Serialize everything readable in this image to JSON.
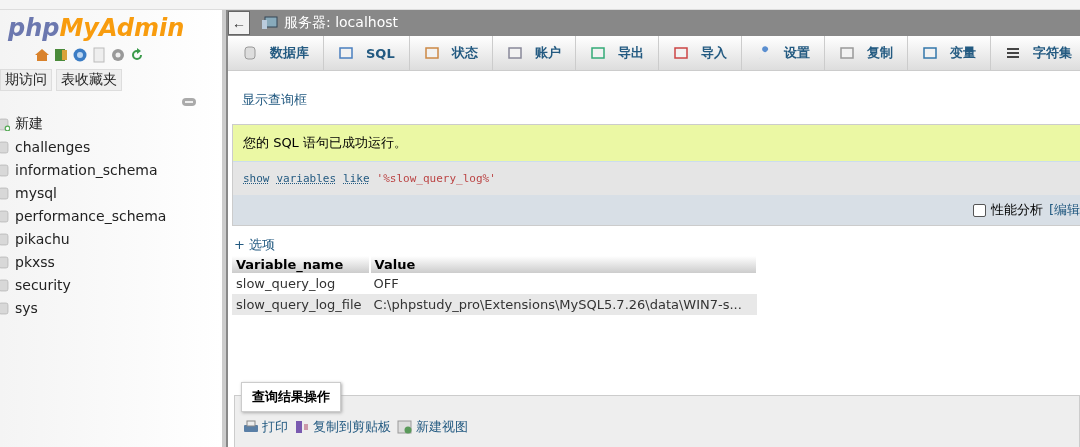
{
  "sidebar": {
    "logo": {
      "part1": "php",
      "part2": "MyAdmin"
    },
    "tabs": [
      {
        "label": "期访问",
        "selected": false
      },
      {
        "label": "表收藏夹",
        "selected": false
      }
    ],
    "tree": [
      {
        "label": "新建",
        "kind": "new"
      },
      {
        "label": "challenges",
        "kind": "db"
      },
      {
        "label": "information_schema",
        "kind": "db"
      },
      {
        "label": "mysql",
        "kind": "db"
      },
      {
        "label": "performance_schema",
        "kind": "db"
      },
      {
        "label": "pikachu",
        "kind": "db"
      },
      {
        "label": "pkxss",
        "kind": "db"
      },
      {
        "label": "security",
        "kind": "db"
      },
      {
        "label": "sys",
        "kind": "db"
      }
    ]
  },
  "breadcrumb": {
    "back": "←",
    "server": "服务器: localhost"
  },
  "tabs": [
    {
      "label": "数据库",
      "selected": false
    },
    {
      "label": "SQL",
      "selected": false
    },
    {
      "label": "状态",
      "selected": false
    },
    {
      "label": "账户",
      "selected": false
    },
    {
      "label": "导出",
      "selected": false
    },
    {
      "label": "导入",
      "selected": false
    },
    {
      "label": "设置",
      "selected": false
    },
    {
      "label": "复制",
      "selected": false
    },
    {
      "label": "变量",
      "selected": false
    },
    {
      "label": "字符集",
      "selected": false
    }
  ],
  "show_query_link": "显示查询框",
  "message": "您的 SQL 语句已成功运行。",
  "sql": [
    {
      "text": "show",
      "kind": "keyword"
    },
    {
      "text": "variables",
      "kind": "keyword"
    },
    {
      "text": "like",
      "kind": "keyword"
    },
    {
      "text": "'%slow_query_log%'",
      "kind": "string"
    }
  ],
  "profiling": {
    "label": "性能分析",
    "checked": false,
    "edit_link": "[编辑"
  },
  "options_link": "+ 选项",
  "table": {
    "columns": [
      "Variable_name",
      "Value"
    ],
    "rows": [
      [
        "slow_query_log",
        "OFF"
      ],
      [
        "slow_query_log_file",
        "C:\\phpstudy_pro\\Extensions\\MySQL5.7.26\\data\\WIN7-s..."
      ]
    ]
  },
  "result_ops": {
    "legend": "查询结果操作",
    "links": [
      "打印",
      "复制到剪贴板",
      "新建视图"
    ]
  }
}
